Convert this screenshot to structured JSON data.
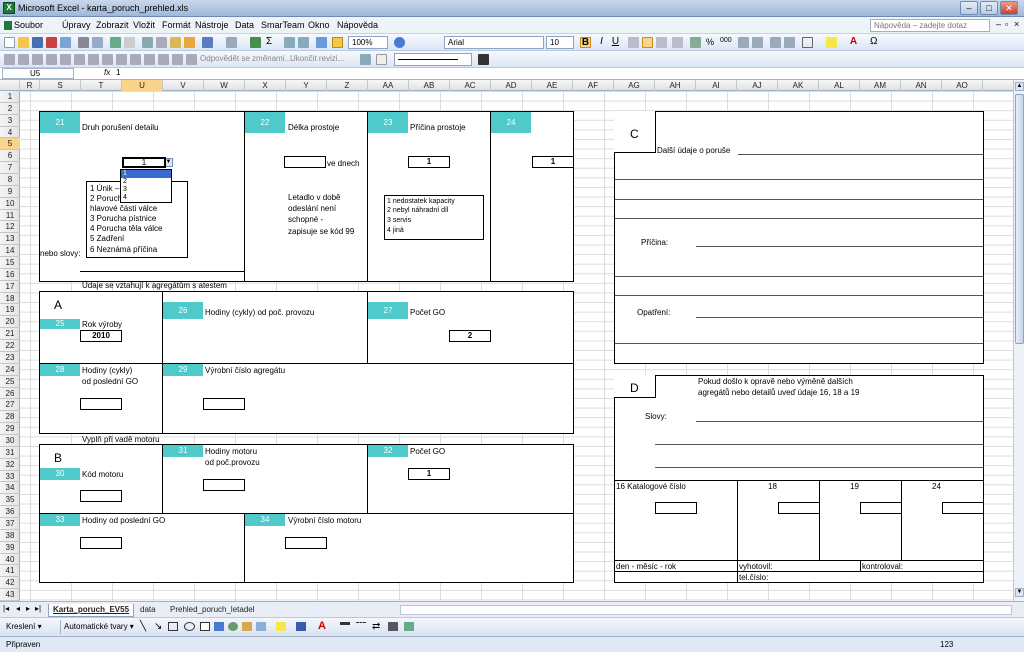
{
  "app": {
    "title": "Microsoft Excel - karta_poruch_prehled.xls",
    "help_placeholder": "Nápověda – zadejte dotaz"
  },
  "menu": [
    "Soubor",
    "Úpravy",
    "Zobrazit",
    "Vložit",
    "Formát",
    "Nástroje",
    "Data",
    "SmarTeam",
    "Okno",
    "Nápověda"
  ],
  "toolbar": {
    "zoom": "100%",
    "font": "Arial",
    "size": "10",
    "review_reply": "Odpovědět se změnami...",
    "review_end": "Ukončit revizi..."
  },
  "formula": {
    "namebox": "U5",
    "fx": "fx",
    "value": "1"
  },
  "columns": [
    "R",
    "S",
    "T",
    "U",
    "V",
    "W",
    "X",
    "Y",
    "Z",
    "AA",
    "AB",
    "AC",
    "AD",
    "AE",
    "AF",
    "AG",
    "AH",
    "AI",
    "AJ",
    "AK",
    "AL",
    "AM",
    "AN",
    "AO"
  ],
  "rows": [
    "1",
    "2",
    "3",
    "4",
    "5",
    "6",
    "7",
    "8",
    "9",
    "10",
    "11",
    "12",
    "13",
    "14",
    "15",
    "16",
    "17",
    "18",
    "19",
    "20",
    "21",
    "22",
    "23",
    "24",
    "25",
    "26",
    "27",
    "28",
    "29",
    "30",
    "31",
    "32",
    "33",
    "34",
    "35",
    "36",
    "37",
    "38",
    "39",
    "40",
    "41",
    "42",
    "43"
  ],
  "form": {
    "f21": "21",
    "druh": "Druh porušení detailu",
    "dd_value": "1",
    "dd_opts": [
      "1",
      "2",
      "3",
      "4"
    ],
    "list_druh": [
      "1 Únik –",
      "2 Poruch",
      "hlavové části válce",
      "3 Porucha pístnice",
      "4 Porucha těla válce",
      "5 Zadření",
      "6 Neznámá příčina"
    ],
    "nebo_slovy": "nebo slovy:",
    "f22": "22",
    "delka": "Délka prostoje",
    "ve_dnech": "ve dnech",
    "letadlo": [
      "Letadlo v době",
      "odeslání není",
      "schopné -",
      "zapisuje se kód 99"
    ],
    "f23": "23",
    "pricina": "Příčina prostoje",
    "pricina_val": "1",
    "list_pricina": [
      "1 nedostatek kapacity",
      "2 nebyl náhradní díl",
      "3 servis",
      "4 jiná"
    ],
    "f24": "24",
    "f24_val": "1",
    "agregaty": "Údaje se vztahují k agregátům s atestem",
    "A": "A",
    "f25": "25",
    "rok": "Rok výroby",
    "rok_val": "2010",
    "f26": "26",
    "hodiny_poc": "Hodiny (cykly) od poč. provozu",
    "f27": "27",
    "pocet_go": "Počet GO",
    "pocet_go_val": "2",
    "f28": "28",
    "hodiny_go": [
      "Hodiny (cykly)",
      "od poslední GO"
    ],
    "f29": "29",
    "vyrobni_agr": "Výrobní číslo agregátu",
    "vyplni": "Vyplň při vadě motoru",
    "B": "B",
    "f30": "30",
    "kod_motoru": "Kód motoru",
    "f31": "31",
    "hodiny_motoru": [
      "Hodiny motoru",
      "od poč.provozu"
    ],
    "f32": "32",
    "pocet_go2": "Počet GO",
    "pocet_go2_val": "1",
    "f33": "33",
    "hodiny_posl": "Hodiny od poslední GO",
    "f34": "34",
    "vyrobni_motor": "Výrobní číslo motoru",
    "C": "C",
    "dalsi": "Další údaje o poruše",
    "pricina_c": "Příčina:",
    "opatreni": "Opatření:",
    "D": "D",
    "pokud": [
      "Pokud došlo k opravě nebo výměně dalších",
      "agregátů nebo detailů uveď údaje 16, 18 a 19"
    ],
    "slovy": "Slovy:",
    "katalog": "16 Katalogové číslo",
    "k18": "18",
    "k19": "19",
    "k24": "24",
    "den": "den - měsíc - rok",
    "vyhotovil": "vyhotovil:",
    "kontroloval": "kontroloval:",
    "tel": "tel.číslo:"
  },
  "sheets": [
    "Karta_poruch_EV55",
    "data",
    "Prehled_poruch_letadel"
  ],
  "draw": {
    "kresleni": "Kreslení ▾",
    "tvary": "Automatické tvary ▾"
  },
  "status": {
    "left": "Připraven",
    "right": "123"
  }
}
